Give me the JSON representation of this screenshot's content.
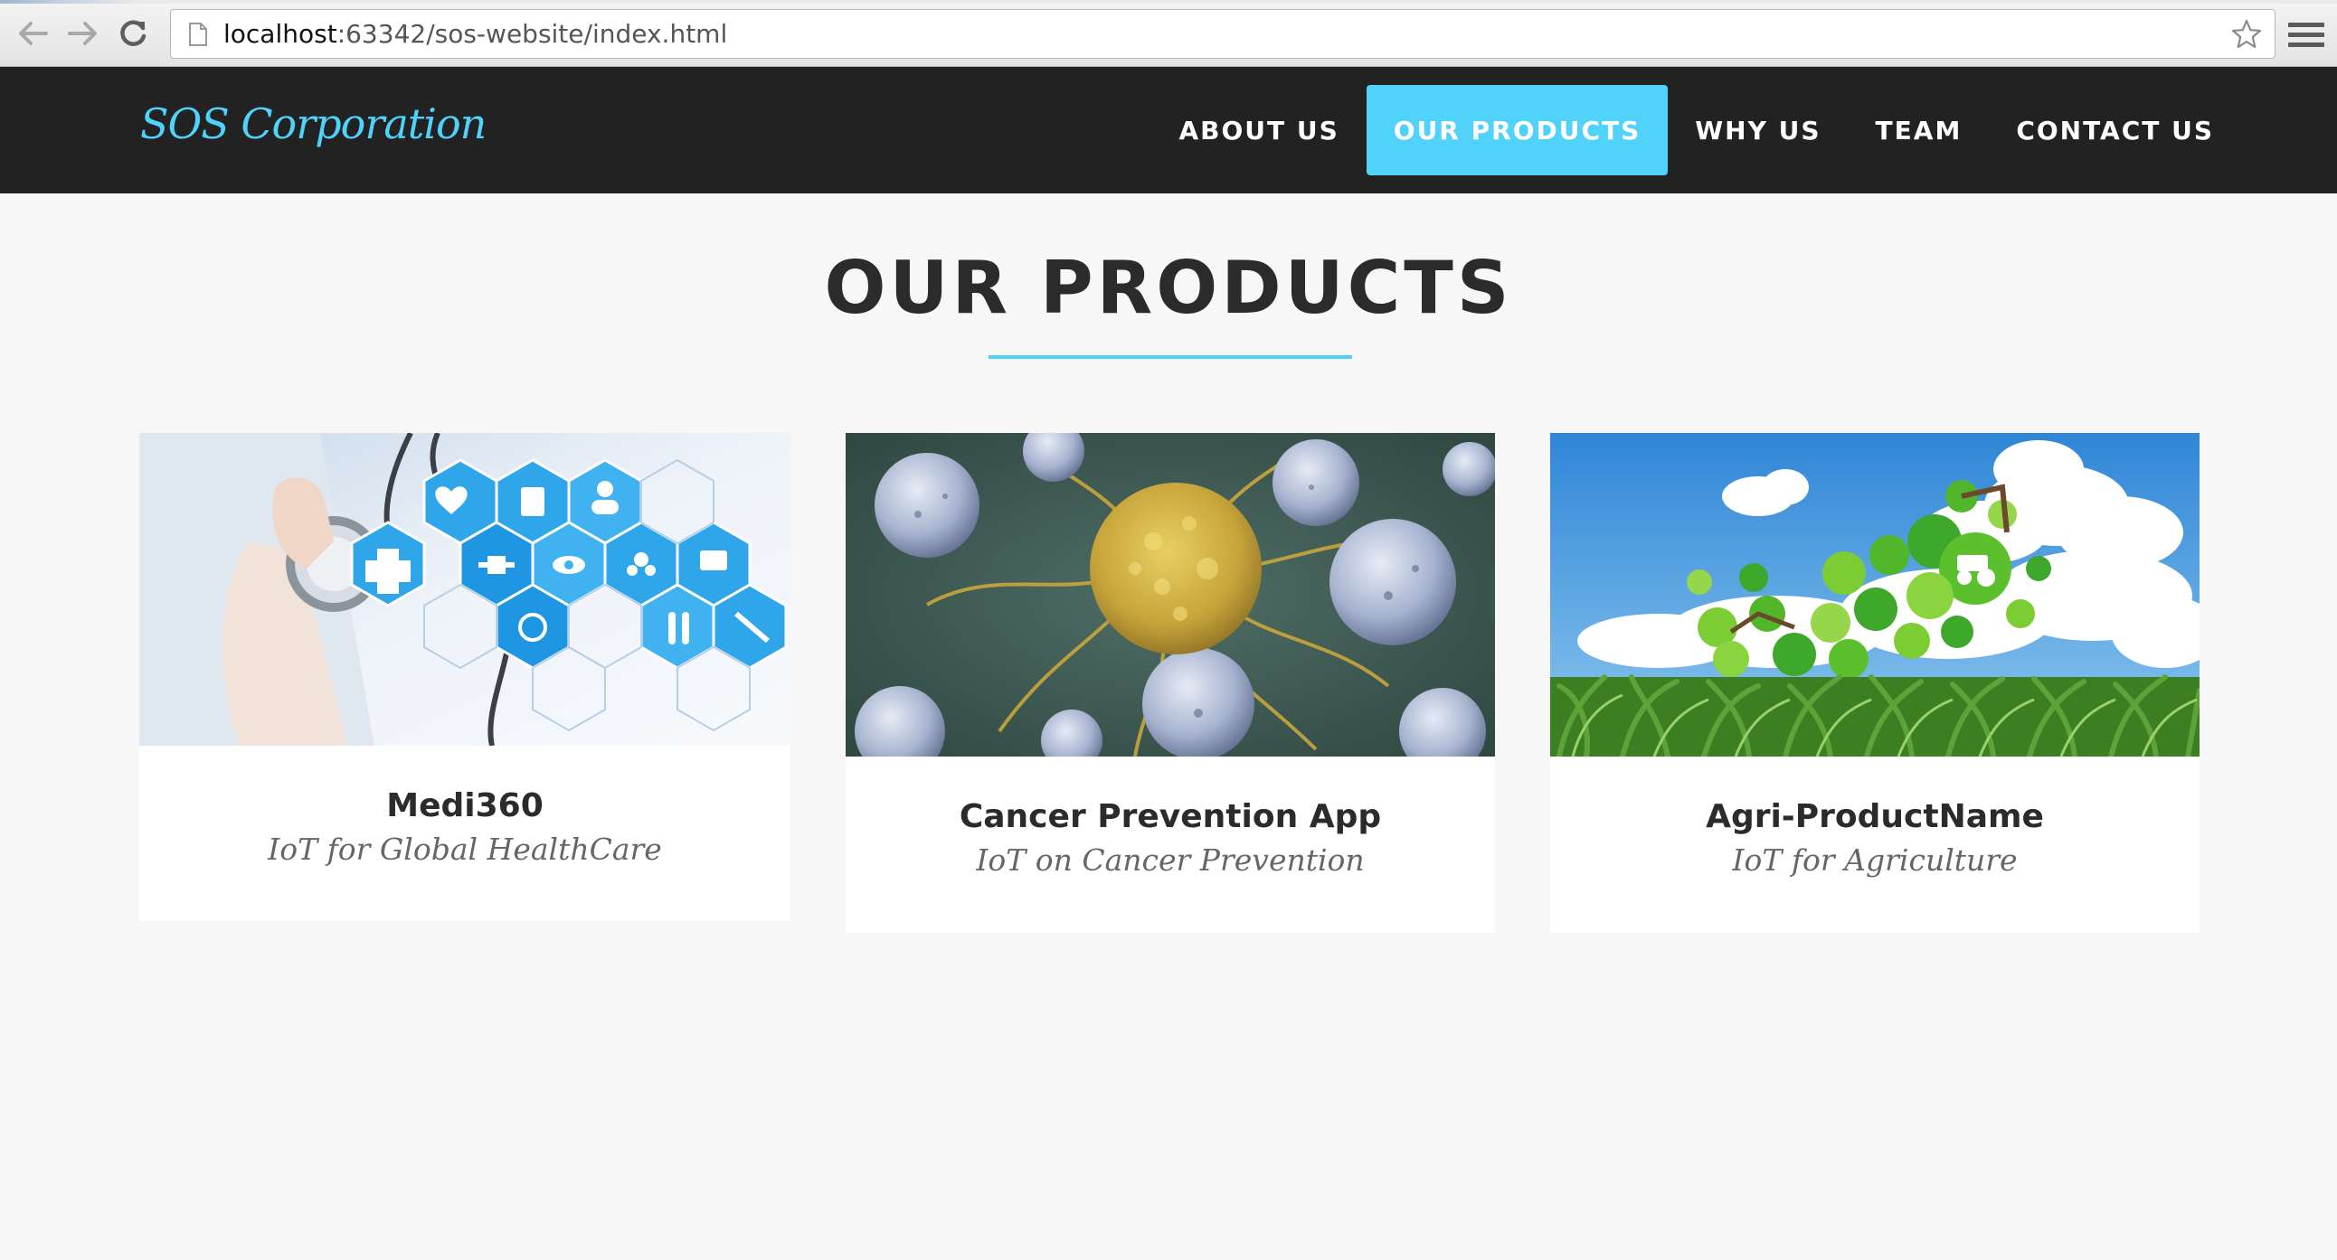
{
  "browser": {
    "url_host": "localhost",
    "url_rest": ":63342/sos-website/index.html",
    "back_icon": "arrow-left-icon",
    "forward_icon": "arrow-right-icon",
    "reload_icon": "reload-icon",
    "bookmark_icon": "star-icon",
    "menu_icon": "hamburger-menu-icon"
  },
  "site": {
    "brand": "SOS Corporation",
    "nav": [
      {
        "label": "ABOUT US",
        "active": false
      },
      {
        "label": "OUR PRODUCTS",
        "active": true
      },
      {
        "label": "WHY US",
        "active": false
      },
      {
        "label": "TEAM",
        "active": false
      },
      {
        "label": "CONTACT US",
        "active": false
      }
    ]
  },
  "products_section": {
    "title": "OUR PRODUCTS",
    "products": [
      {
        "name": "Medi360",
        "tagline": "IoT for Global HealthCare"
      },
      {
        "name": "Cancer Prevention App",
        "tagline": "IoT on Cancer Prevention"
      },
      {
        "name": "Agri-ProductName",
        "tagline": "IoT for Agriculture"
      }
    ]
  },
  "colors": {
    "accent": "#50d2fa",
    "navbar": "#222222",
    "page_bg": "#f7f7f7",
    "card_bg": "#ffffff"
  }
}
